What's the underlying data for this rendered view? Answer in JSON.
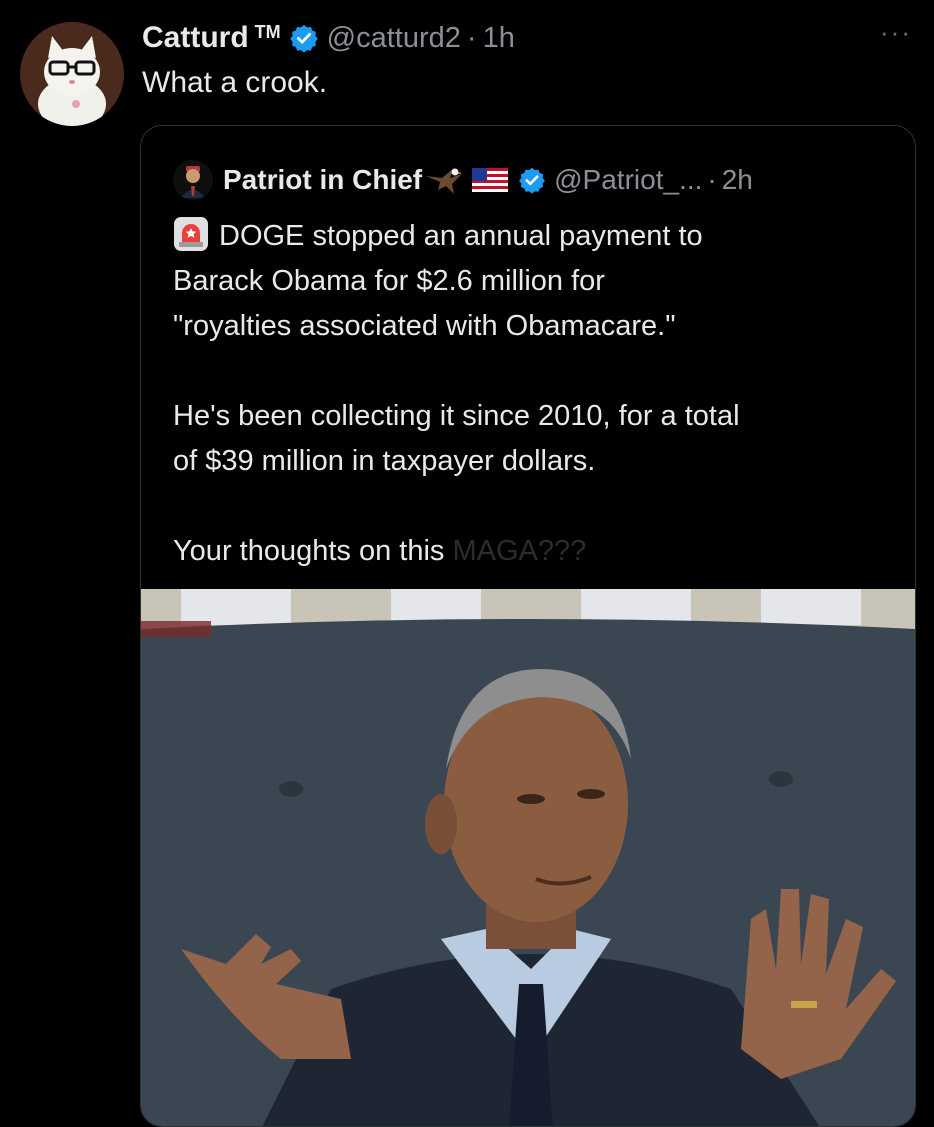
{
  "tweet": {
    "author_name": "Catturd",
    "author_tm": "TM",
    "handle": "@catturd2",
    "separator": "·",
    "time": "1h",
    "text": "What a crook.",
    "more_label": "···"
  },
  "quoted_tweet": {
    "author_name": "Patriot in Chief",
    "handle": "@Patriot_...",
    "separator": "·",
    "time": "2h",
    "lines": [
      "DOGE stopped an annual payment to",
      "Barack Obama for $2.6 million for",
      "\"royalties associated with Obamacare.\"",
      "He's been collecting it since 2010, for a total",
      "of $39 million in taxpayer dollars."
    ],
    "question": "Your thoughts on this ",
    "question_faded": "MAGA???"
  },
  "icons": {
    "more": "more-icon",
    "verified": "verified-badge-icon",
    "eagle": "eagle-icon",
    "flag": "us-flag-icon",
    "siren": "siren-icon"
  },
  "colors": {
    "background": "#000000",
    "text": "#e7e9ea",
    "secondary_text": "#8b9096",
    "verified": "#1d9bf0",
    "border": "#2f3336"
  }
}
